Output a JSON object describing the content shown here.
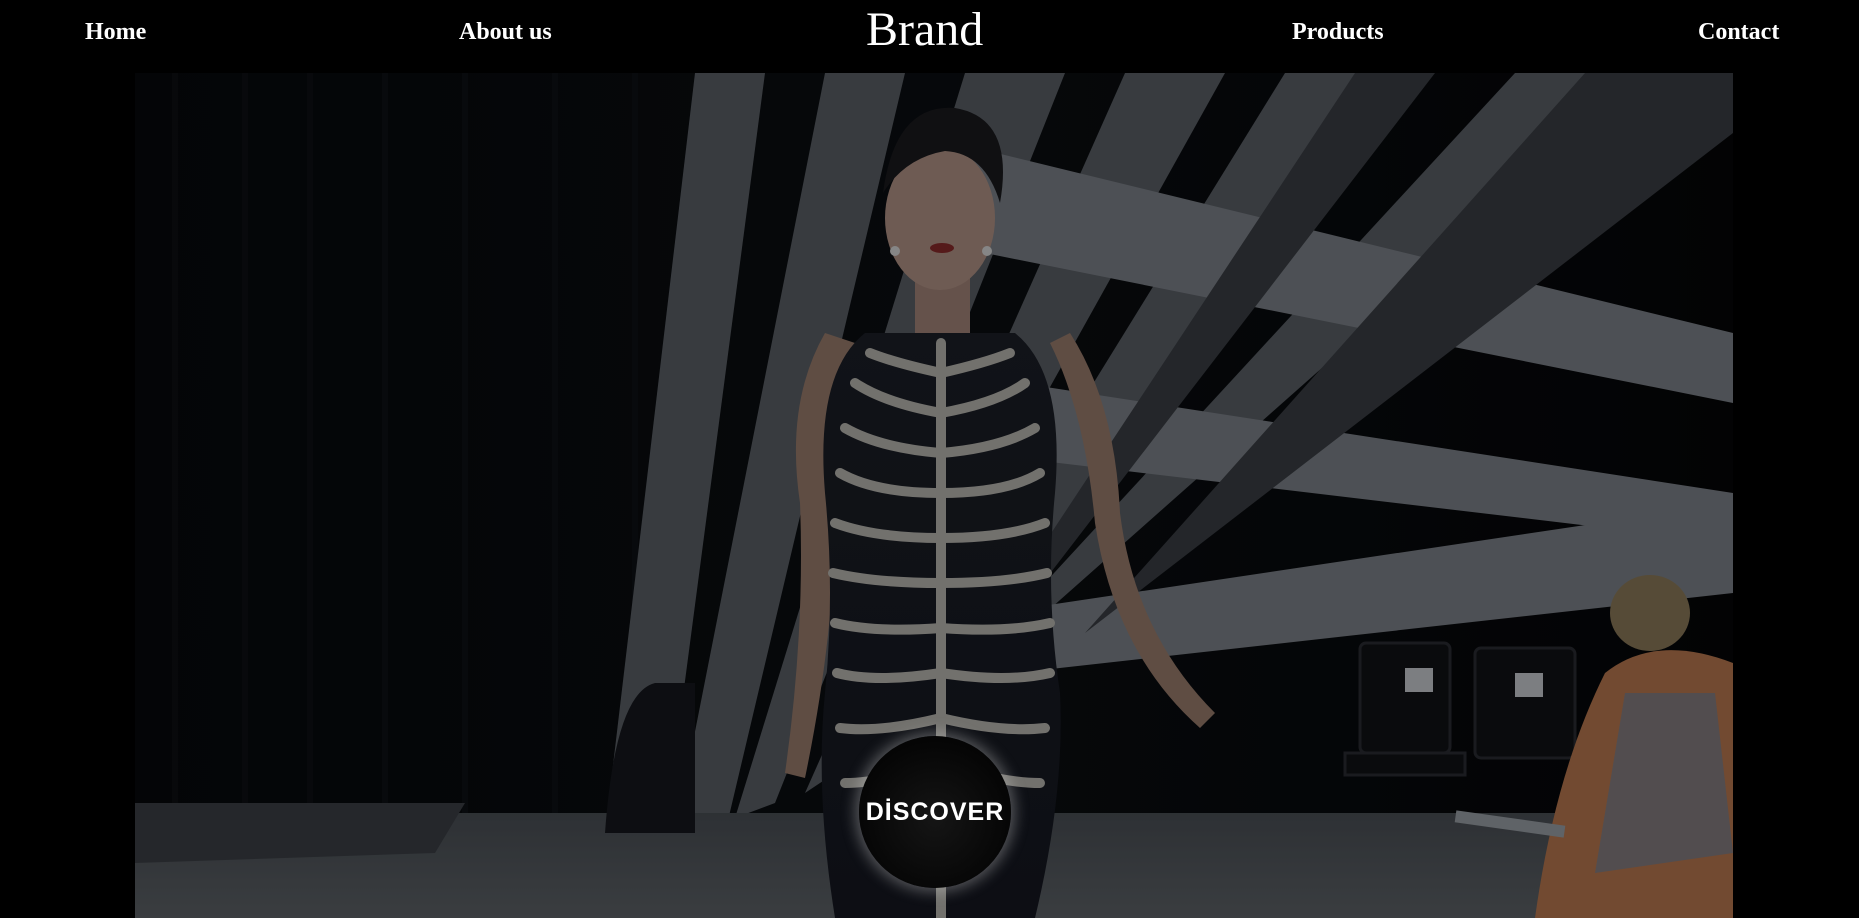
{
  "nav": {
    "home_label": "Home",
    "about_label": "About us",
    "brand_label": "Brand",
    "products_label": "Products",
    "contact_label": "Contact"
  },
  "hero": {
    "discover_label": "DİSCOVER"
  },
  "colors": {
    "background": "#000000",
    "text": "#ffffff"
  }
}
